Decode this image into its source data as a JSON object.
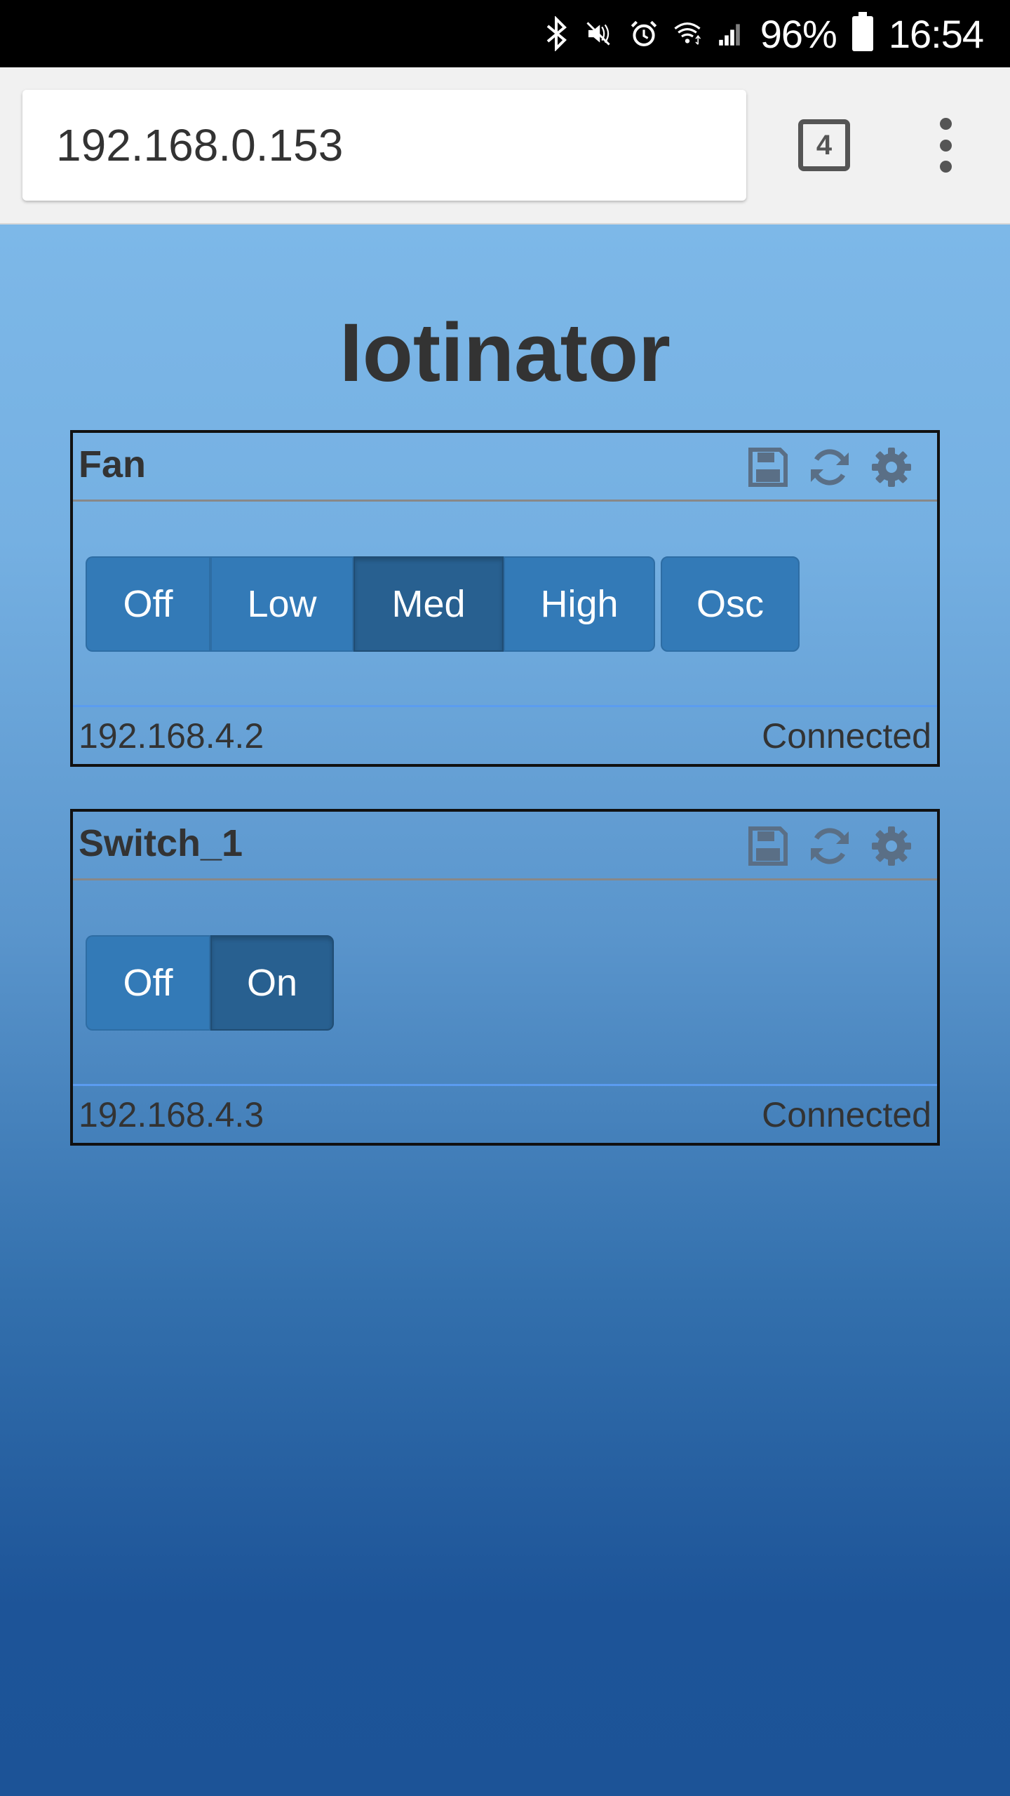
{
  "status_bar": {
    "battery": "96%",
    "time": "16:54",
    "icons": [
      "bluetooth-icon",
      "mute-icon",
      "alarm-icon",
      "wifi-icon",
      "signal-icon",
      "battery-icon"
    ]
  },
  "browser": {
    "url": "192.168.0.153",
    "tab_count": "4"
  },
  "page": {
    "title": "Iotinator",
    "devices": [
      {
        "name": "Fan",
        "buttons": [
          "Off",
          "Low",
          "Med",
          "High"
        ],
        "active": "Med",
        "extra_button": "Osc",
        "ip": "192.168.4.2",
        "status": "Connected"
      },
      {
        "name": "Switch_1",
        "buttons": [
          "Off",
          "On"
        ],
        "active": "On",
        "ip": "192.168.4.3",
        "status": "Connected"
      }
    ]
  },
  "colors": {
    "button": "#337ab7",
    "button_active": "#286090",
    "icon_gray": "#5a6f86"
  }
}
